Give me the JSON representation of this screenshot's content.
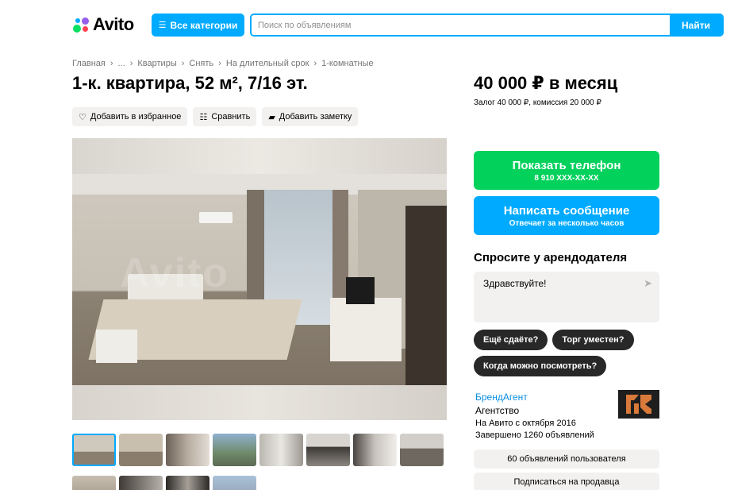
{
  "header": {
    "logo_text": "Avito",
    "categories_button": "Все категории",
    "search_placeholder": "Поиск по объявлениям",
    "search_button": "Найти"
  },
  "breadcrumbs": [
    "Главная",
    "...",
    "Квартиры",
    "Снять",
    "На длительный срок",
    "1-комнатные"
  ],
  "listing": {
    "title": "1-к. квартира, 52 м², 7/16 эт.",
    "actions": {
      "favorite": "Добавить в избранное",
      "compare": "Сравнить",
      "note": "Добавить заметку"
    },
    "photo_watermark": "Avito",
    "photo_count_visible": 12
  },
  "price": {
    "main": "40 000 ₽ в месяц",
    "details": "Залог 40 000 ₽, комиссия 20 000 ₽"
  },
  "contact": {
    "phone_label": "Показать телефон",
    "phone_masked": "8 910 XXX-XX-XX",
    "message_label": "Написать сообщение",
    "message_sub": "Отвечает за несколько часов"
  },
  "ask": {
    "heading": "Спросите у арендодателя",
    "message_value": "Здравствуйте!",
    "quick_questions": [
      "Ещё сдаёте?",
      "Торг уместен?",
      "Когда можно посмотреть?"
    ]
  },
  "seller": {
    "name": "БрендАгент",
    "type": "Агентство",
    "since": "На Авито с октября 2016",
    "completed": "Завершено 1260 объявлений",
    "listings_button": "60 объявлений пользователя",
    "subscribe_button": "Подписаться на продавца"
  },
  "colors": {
    "accent": "#00aaff",
    "phone_green": "#02d15c",
    "chip_dark": "#282828",
    "link_blue": "#0a8fe0"
  }
}
